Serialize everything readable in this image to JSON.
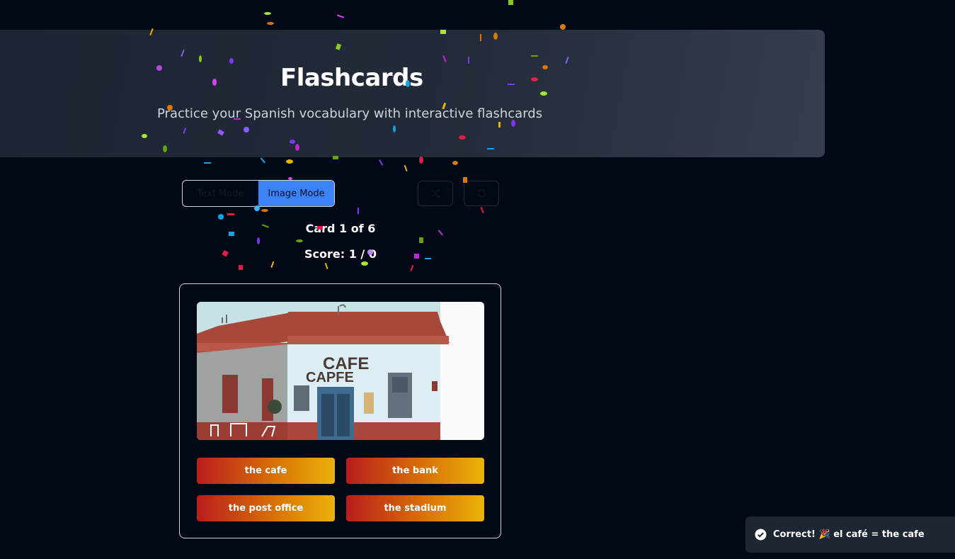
{
  "header": {
    "title": "Flashcards",
    "subtitle": "Practice your Spanish vocabulary with interactive flashcards"
  },
  "mode_toggle": {
    "text_label": "Text Mode",
    "image_label": "Image Mode",
    "active": "Image Mode"
  },
  "toolbar": {
    "shuffle_icon": "shuffle-icon",
    "reset_icon": "reset-icon"
  },
  "progress": {
    "card_label": "Card 1 of 6",
    "score_label": "Score: 1 / 0"
  },
  "card": {
    "image_sign_text": "CAFE",
    "image_sign_text_2": "CAPFE",
    "answers": [
      "the cafe",
      "the bank",
      "the post office",
      "the stadium"
    ]
  },
  "toast": {
    "message": "Correct! 🎉 el café = the cafe",
    "icon": "check-circle-icon"
  },
  "colors": {
    "background": "#030817",
    "accent": "#3b82f6",
    "answer_gradient_start": "#b91c1c",
    "answer_gradient_end": "#eab308"
  }
}
